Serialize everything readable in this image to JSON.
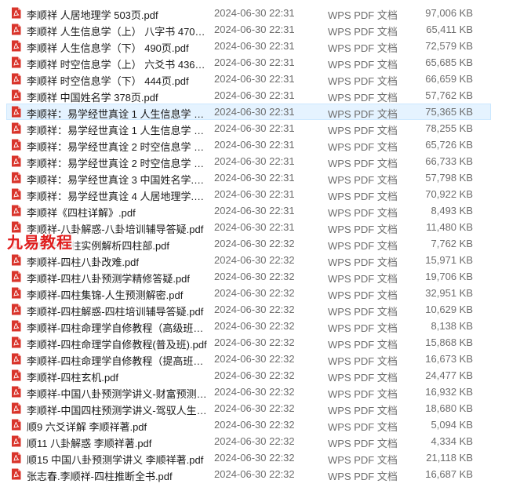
{
  "colors": {
    "pdf_icon": "#d9342b",
    "selected_bg": "#e5f3ff",
    "selected_border": "#cce8ff",
    "watermark": "#e01e1e"
  },
  "watermark_text": "九易教程",
  "selected_index": 6,
  "files": [
    {
      "name": "李顺祥 人居地理学 503页.pdf",
      "date": "2024-06-30 22:31",
      "type": "WPS PDF 文档",
      "size": "97,006 KB"
    },
    {
      "name": "李顺祥 人生信息学（上） 八字书 470页....",
      "date": "2024-06-30 22:31",
      "type": "WPS PDF 文档",
      "size": "65,411 KB"
    },
    {
      "name": "李顺祥 人生信息学（下） 490页.pdf",
      "date": "2024-06-30 22:31",
      "type": "WPS PDF 文档",
      "size": "72,579 KB"
    },
    {
      "name": "李顺祥 时空信息学（上） 六爻书 436页....",
      "date": "2024-06-30 22:31",
      "type": "WPS PDF 文档",
      "size": "65,685 KB"
    },
    {
      "name": "李顺祥 时空信息学（下） 444页.pdf",
      "date": "2024-06-30 22:31",
      "type": "WPS PDF 文档",
      "size": "66,659 KB"
    },
    {
      "name": "李顺祥 中国姓名学 378页.pdf",
      "date": "2024-06-30 22:31",
      "type": "WPS PDF 文档",
      "size": "57,762 KB"
    },
    {
      "name": "李顺祥：易学经世真诠 1 人生信息学 上...",
      "date": "2024-06-30 22:31",
      "type": "WPS PDF 文档",
      "size": "75,365 KB"
    },
    {
      "name": "李顺祥：易学经世真诠 1 人生信息学 下...",
      "date": "2024-06-30 22:31",
      "type": "WPS PDF 文档",
      "size": "78,255 KB"
    },
    {
      "name": "李顺祥：易学经世真诠 2 时空信息学 上...",
      "date": "2024-06-30 22:31",
      "type": "WPS PDF 文档",
      "size": "65,726 KB"
    },
    {
      "name": "李顺祥：易学经世真诠 2 时空信息学 下...",
      "date": "2024-06-30 22:31",
      "type": "WPS PDF 文档",
      "size": "66,733 KB"
    },
    {
      "name": "李顺祥：易学经世真诠 3 中国姓名学.pdf",
      "date": "2024-06-30 22:31",
      "type": "WPS PDF 文档",
      "size": "57,798 KB"
    },
    {
      "name": "李顺祥：易学经世真诠 4 人居地理学.pdf",
      "date": "2024-06-30 22:31",
      "type": "WPS PDF 文档",
      "size": "70,922 KB"
    },
    {
      "name": "李顺祥《四柱详解》.pdf",
      "date": "2024-06-30 22:31",
      "type": "WPS PDF 文档",
      "size": "8,493 KB"
    },
    {
      "name": "李顺祥-八卦解惑-八卦培训辅导答疑.pdf",
      "date": "2024-06-30 22:31",
      "type": "WPS PDF 文档",
      "size": "11,480 KB"
    },
    {
      "name": "李顺祥-四柱实例解析四柱部.pdf",
      "date": "2024-06-30 22:32",
      "type": "WPS PDF 文档",
      "size": "7,762 KB"
    },
    {
      "name": "李顺祥-四柱八卦改难.pdf",
      "date": "2024-06-30 22:32",
      "type": "WPS PDF 文档",
      "size": "15,971 KB"
    },
    {
      "name": "李顺祥-四柱八卦预测学精修答疑.pdf",
      "date": "2024-06-30 22:32",
      "type": "WPS PDF 文档",
      "size": "19,706 KB"
    },
    {
      "name": "李顺祥-四柱集锦-人生预测解密.pdf",
      "date": "2024-06-30 22:32",
      "type": "WPS PDF 文档",
      "size": "32,951 KB"
    },
    {
      "name": "李顺祥-四柱解惑-四柱培训辅导答疑.pdf",
      "date": "2024-06-30 22:32",
      "type": "WPS PDF 文档",
      "size": "10,629 KB"
    },
    {
      "name": "李顺祥-四柱命理学自修教程（高级班）....",
      "date": "2024-06-30 22:32",
      "type": "WPS PDF 文档",
      "size": "8,138 KB"
    },
    {
      "name": "李顺祥-四柱命理学自修教程(普及班).pdf",
      "date": "2024-06-30 22:32",
      "type": "WPS PDF 文档",
      "size": "15,868 KB"
    },
    {
      "name": "李顺祥-四柱命理学自修教程（提高班）....",
      "date": "2024-06-30 22:32",
      "type": "WPS PDF 文档",
      "size": "16,673 KB"
    },
    {
      "name": "李顺祥-四柱玄机.pdf",
      "date": "2024-06-30 22:32",
      "type": "WPS PDF 文档",
      "size": "24,477 KB"
    },
    {
      "name": "李顺祥-中国八卦预测学讲义-财富预测深...",
      "date": "2024-06-30 22:32",
      "type": "WPS PDF 文档",
      "size": "16,932 KB"
    },
    {
      "name": "李顺祥-中国四柱预测学讲义-驾驭人生深...",
      "date": "2024-06-30 22:32",
      "type": "WPS PDF 文档",
      "size": "18,680 KB"
    },
    {
      "name": "顺9 六爻详解  李顺祥著.pdf",
      "date": "2024-06-30 22:32",
      "type": "WPS PDF 文档",
      "size": "5,094 KB"
    },
    {
      "name": "顺11 八卦解惑  李顺祥著.pdf",
      "date": "2024-06-30 22:32",
      "type": "WPS PDF 文档",
      "size": "4,334 KB"
    },
    {
      "name": "顺15 中国八卦预测学讲义 李顺祥著.pdf",
      "date": "2024-06-30 22:32",
      "type": "WPS PDF 文档",
      "size": "21,118 KB"
    },
    {
      "name": "张志春.李顺祥-四柱推断全书.pdf",
      "date": "2024-06-30 22:32",
      "type": "WPS PDF 文档",
      "size": "16,687 KB"
    }
  ]
}
